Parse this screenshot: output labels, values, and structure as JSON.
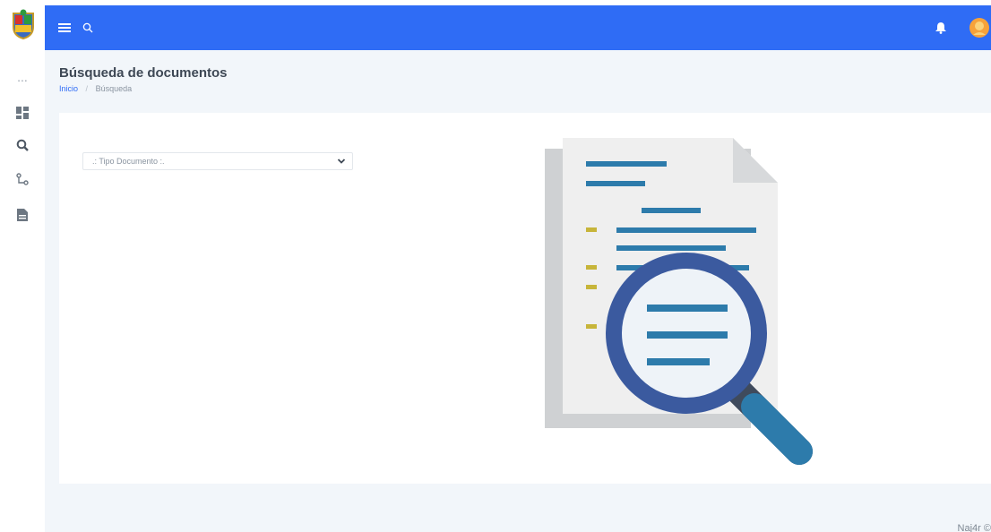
{
  "header": {
    "menu_icon": "hamburger-menu-icon",
    "search_icon": "search-icon",
    "notification_icon": "bell-icon",
    "avatar_icon": "user-avatar-icon",
    "brand_color": "#2f6cf5"
  },
  "sidebar": {
    "items": [
      {
        "icon": "ellipsis-icon",
        "label": "..."
      },
      {
        "icon": "dashboard-icon"
      },
      {
        "icon": "document-search-icon"
      },
      {
        "icon": "workflow-icon"
      },
      {
        "icon": "file-icon"
      }
    ]
  },
  "page": {
    "title": "Búsqueda de documentos",
    "breadcrumb": {
      "home": "Inicio",
      "separator": "/",
      "current": "Búsqueda"
    }
  },
  "form": {
    "document_type": {
      "selected": ".: Tipo Documento :."
    }
  },
  "footer": {
    "text": "Naj4r ©"
  }
}
